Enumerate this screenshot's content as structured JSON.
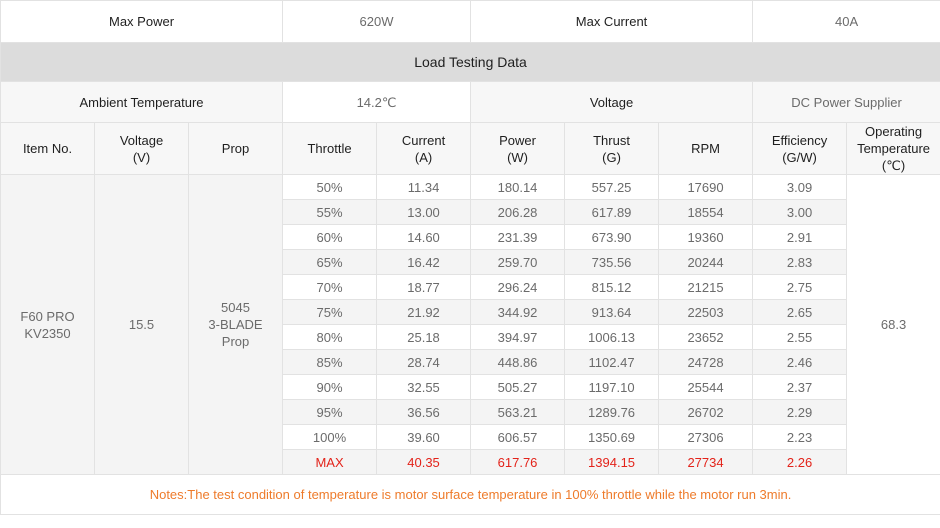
{
  "top": {
    "max_power_label": "Max Power",
    "max_power_value": "620W",
    "max_current_label": "Max Current",
    "max_current_value": "40A"
  },
  "section_title": "Load Testing Data",
  "conditions": {
    "ambient_label": "Ambient Temperature",
    "ambient_value": "14.2℃",
    "voltage_label": "Voltage",
    "voltage_value": "DC Power Supplier"
  },
  "headers": {
    "item_no": "Item No.",
    "voltage": [
      "Voltage",
      "(V)"
    ],
    "prop": "Prop",
    "throttle": "Throttle",
    "current": [
      "Current",
      "(A)"
    ],
    "power": [
      "Power",
      "(W)"
    ],
    "thrust": [
      "Thrust",
      "(G)"
    ],
    "rpm": "RPM",
    "efficiency": [
      "Efficiency",
      "(G/W)"
    ],
    "op_temp": [
      "Operating",
      "Temperature",
      "(℃)"
    ]
  },
  "item": {
    "name": [
      "F60 PRO",
      "KV2350"
    ],
    "voltage": "15.5",
    "prop": [
      "5045",
      "3-BLADE",
      "Prop"
    ],
    "op_temp": "68.3"
  },
  "rows": [
    {
      "throttle": "50%",
      "current": "11.34",
      "power": "180.14",
      "thrust": "557.25",
      "rpm": "17690",
      "efficiency": "3.09"
    },
    {
      "throttle": "55%",
      "current": "13.00",
      "power": "206.28",
      "thrust": "617.89",
      "rpm": "18554",
      "efficiency": "3.00"
    },
    {
      "throttle": "60%",
      "current": "14.60",
      "power": "231.39",
      "thrust": "673.90",
      "rpm": "19360",
      "efficiency": "2.91"
    },
    {
      "throttle": "65%",
      "current": "16.42",
      "power": "259.70",
      "thrust": "735.56",
      "rpm": "20244",
      "efficiency": "2.83"
    },
    {
      "throttle": "70%",
      "current": "18.77",
      "power": "296.24",
      "thrust": "815.12",
      "rpm": "21215",
      "efficiency": "2.75"
    },
    {
      "throttle": "75%",
      "current": "21.92",
      "power": "344.92",
      "thrust": "913.64",
      "rpm": "22503",
      "efficiency": "2.65"
    },
    {
      "throttle": "80%",
      "current": "25.18",
      "power": "394.97",
      "thrust": "1006.13",
      "rpm": "23652",
      "efficiency": "2.55"
    },
    {
      "throttle": "85%",
      "current": "28.74",
      "power": "448.86",
      "thrust": "1102.47",
      "rpm": "24728",
      "efficiency": "2.46"
    },
    {
      "throttle": "90%",
      "current": "32.55",
      "power": "505.27",
      "thrust": "1197.10",
      "rpm": "25544",
      "efficiency": "2.37"
    },
    {
      "throttle": "95%",
      "current": "36.56",
      "power": "563.21",
      "thrust": "1289.76",
      "rpm": "26702",
      "efficiency": "2.29"
    },
    {
      "throttle": "100%",
      "current": "39.60",
      "power": "606.57",
      "thrust": "1350.69",
      "rpm": "27306",
      "efficiency": "2.23"
    },
    {
      "throttle": "MAX",
      "current": "40.35",
      "power": "617.76",
      "thrust": "1394.15",
      "rpm": "27734",
      "efficiency": "2.26"
    }
  ],
  "note": "Notes:The test condition of temperature is motor surface temperature in 100% throttle while the motor run 3min.",
  "colors": {
    "max_row_text": "#e3231a",
    "note_text": "#ee7b2b",
    "section_bg": "#dcdcdc",
    "zebra_bg": "#f4f4f4"
  }
}
